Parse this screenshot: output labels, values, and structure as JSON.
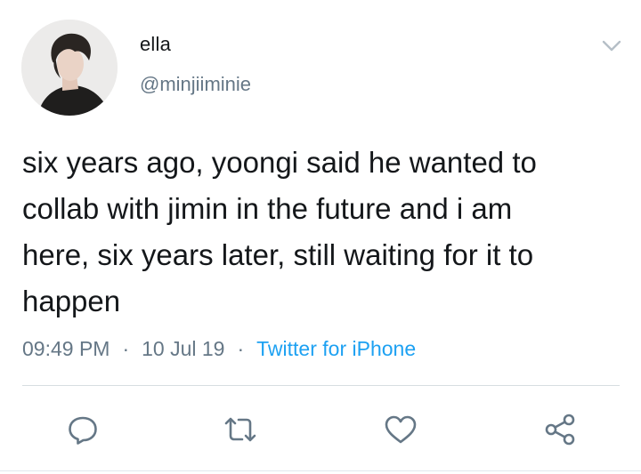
{
  "user": {
    "display_name": "ella",
    "handle": "@minjiiminie"
  },
  "tweet": {
    "text": "six years ago, yoongi said he wanted to\ncollab with jimin in the future and i am\nhere, six years later, still waiting for it to\nhappen",
    "time": "09:49 PM",
    "separator": "·",
    "date": "10 Jul 19",
    "source": "Twitter for iPhone"
  },
  "actions": [
    "reply-icon",
    "retweet-icon",
    "like-icon",
    "share-icon"
  ],
  "colors": {
    "text": "#14171a",
    "secondary": "#657786",
    "link": "#1da1f2",
    "icon": "#657786"
  }
}
